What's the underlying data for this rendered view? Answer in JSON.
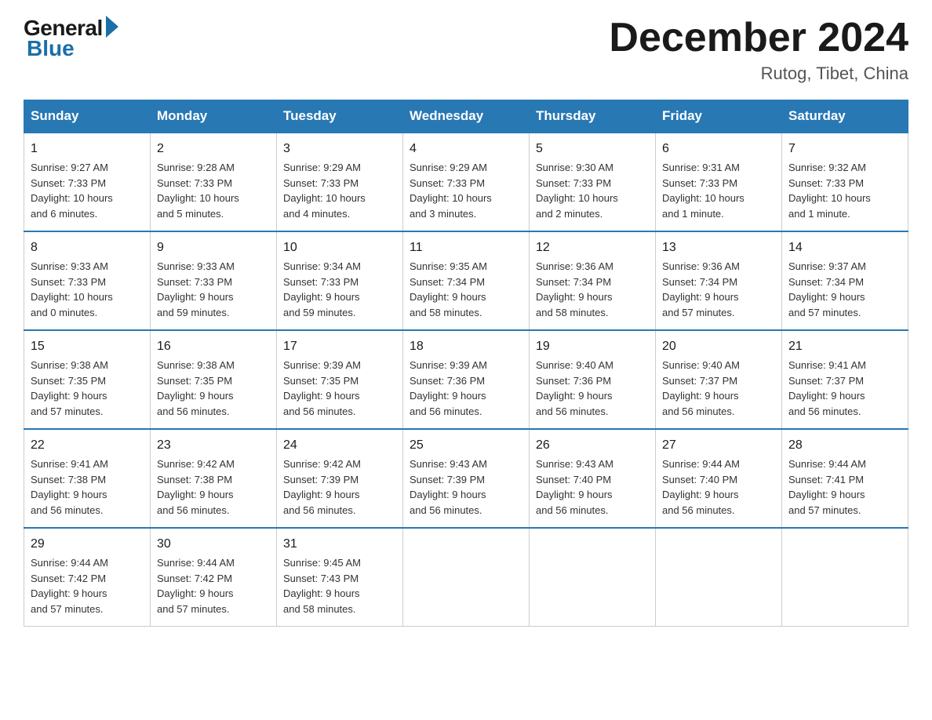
{
  "logo": {
    "general": "General",
    "blue": "Blue"
  },
  "title": "December 2024",
  "location": "Rutog, Tibet, China",
  "headers": [
    "Sunday",
    "Monday",
    "Tuesday",
    "Wednesday",
    "Thursday",
    "Friday",
    "Saturday"
  ],
  "weeks": [
    [
      {
        "day": "1",
        "info": "Sunrise: 9:27 AM\nSunset: 7:33 PM\nDaylight: 10 hours\nand 6 minutes."
      },
      {
        "day": "2",
        "info": "Sunrise: 9:28 AM\nSunset: 7:33 PM\nDaylight: 10 hours\nand 5 minutes."
      },
      {
        "day": "3",
        "info": "Sunrise: 9:29 AM\nSunset: 7:33 PM\nDaylight: 10 hours\nand 4 minutes."
      },
      {
        "day": "4",
        "info": "Sunrise: 9:29 AM\nSunset: 7:33 PM\nDaylight: 10 hours\nand 3 minutes."
      },
      {
        "day": "5",
        "info": "Sunrise: 9:30 AM\nSunset: 7:33 PM\nDaylight: 10 hours\nand 2 minutes."
      },
      {
        "day": "6",
        "info": "Sunrise: 9:31 AM\nSunset: 7:33 PM\nDaylight: 10 hours\nand 1 minute."
      },
      {
        "day": "7",
        "info": "Sunrise: 9:32 AM\nSunset: 7:33 PM\nDaylight: 10 hours\nand 1 minute."
      }
    ],
    [
      {
        "day": "8",
        "info": "Sunrise: 9:33 AM\nSunset: 7:33 PM\nDaylight: 10 hours\nand 0 minutes."
      },
      {
        "day": "9",
        "info": "Sunrise: 9:33 AM\nSunset: 7:33 PM\nDaylight: 9 hours\nand 59 minutes."
      },
      {
        "day": "10",
        "info": "Sunrise: 9:34 AM\nSunset: 7:33 PM\nDaylight: 9 hours\nand 59 minutes."
      },
      {
        "day": "11",
        "info": "Sunrise: 9:35 AM\nSunset: 7:34 PM\nDaylight: 9 hours\nand 58 minutes."
      },
      {
        "day": "12",
        "info": "Sunrise: 9:36 AM\nSunset: 7:34 PM\nDaylight: 9 hours\nand 58 minutes."
      },
      {
        "day": "13",
        "info": "Sunrise: 9:36 AM\nSunset: 7:34 PM\nDaylight: 9 hours\nand 57 minutes."
      },
      {
        "day": "14",
        "info": "Sunrise: 9:37 AM\nSunset: 7:34 PM\nDaylight: 9 hours\nand 57 minutes."
      }
    ],
    [
      {
        "day": "15",
        "info": "Sunrise: 9:38 AM\nSunset: 7:35 PM\nDaylight: 9 hours\nand 57 minutes."
      },
      {
        "day": "16",
        "info": "Sunrise: 9:38 AM\nSunset: 7:35 PM\nDaylight: 9 hours\nand 56 minutes."
      },
      {
        "day": "17",
        "info": "Sunrise: 9:39 AM\nSunset: 7:35 PM\nDaylight: 9 hours\nand 56 minutes."
      },
      {
        "day": "18",
        "info": "Sunrise: 9:39 AM\nSunset: 7:36 PM\nDaylight: 9 hours\nand 56 minutes."
      },
      {
        "day": "19",
        "info": "Sunrise: 9:40 AM\nSunset: 7:36 PM\nDaylight: 9 hours\nand 56 minutes."
      },
      {
        "day": "20",
        "info": "Sunrise: 9:40 AM\nSunset: 7:37 PM\nDaylight: 9 hours\nand 56 minutes."
      },
      {
        "day": "21",
        "info": "Sunrise: 9:41 AM\nSunset: 7:37 PM\nDaylight: 9 hours\nand 56 minutes."
      }
    ],
    [
      {
        "day": "22",
        "info": "Sunrise: 9:41 AM\nSunset: 7:38 PM\nDaylight: 9 hours\nand 56 minutes."
      },
      {
        "day": "23",
        "info": "Sunrise: 9:42 AM\nSunset: 7:38 PM\nDaylight: 9 hours\nand 56 minutes."
      },
      {
        "day": "24",
        "info": "Sunrise: 9:42 AM\nSunset: 7:39 PM\nDaylight: 9 hours\nand 56 minutes."
      },
      {
        "day": "25",
        "info": "Sunrise: 9:43 AM\nSunset: 7:39 PM\nDaylight: 9 hours\nand 56 minutes."
      },
      {
        "day": "26",
        "info": "Sunrise: 9:43 AM\nSunset: 7:40 PM\nDaylight: 9 hours\nand 56 minutes."
      },
      {
        "day": "27",
        "info": "Sunrise: 9:44 AM\nSunset: 7:40 PM\nDaylight: 9 hours\nand 56 minutes."
      },
      {
        "day": "28",
        "info": "Sunrise: 9:44 AM\nSunset: 7:41 PM\nDaylight: 9 hours\nand 57 minutes."
      }
    ],
    [
      {
        "day": "29",
        "info": "Sunrise: 9:44 AM\nSunset: 7:42 PM\nDaylight: 9 hours\nand 57 minutes."
      },
      {
        "day": "30",
        "info": "Sunrise: 9:44 AM\nSunset: 7:42 PM\nDaylight: 9 hours\nand 57 minutes."
      },
      {
        "day": "31",
        "info": "Sunrise: 9:45 AM\nSunset: 7:43 PM\nDaylight: 9 hours\nand 58 minutes."
      },
      {
        "day": "",
        "info": ""
      },
      {
        "day": "",
        "info": ""
      },
      {
        "day": "",
        "info": ""
      },
      {
        "day": "",
        "info": ""
      }
    ]
  ]
}
